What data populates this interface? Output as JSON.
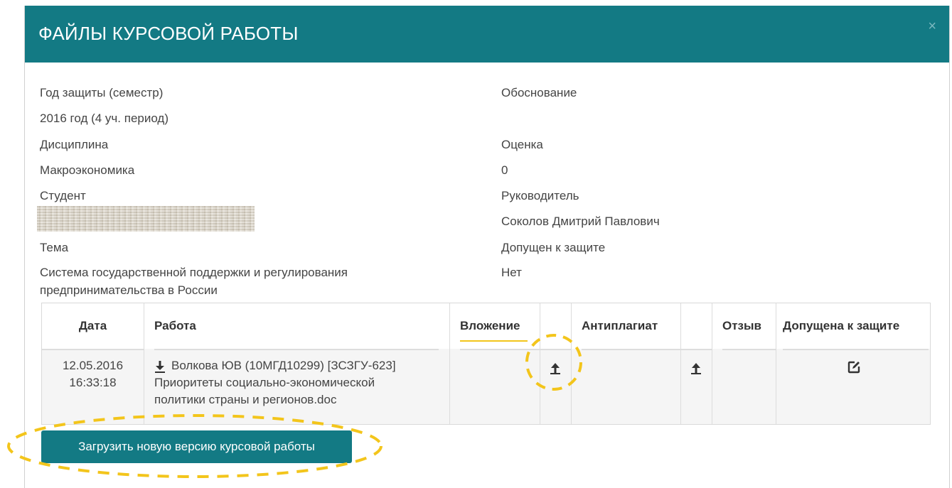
{
  "modal": {
    "title": "ФАЙЛЫ КУРСОВОЙ РАБОТЫ",
    "close_label": "×"
  },
  "info": {
    "year_label": "Год защиты (семестр)",
    "year_value": "2016 год (4 уч. период)",
    "discipline_label": "Дисциплина",
    "discipline_value": "Макроэкономика",
    "student_label": "Студент",
    "topic_label": "Тема",
    "topic_value_line1": "Система государственной поддержки и регулирования",
    "topic_value_line2": "предпринимательства в России",
    "basis_label": "Обоснование",
    "grade_label": "Оценка",
    "grade_value": "0",
    "supervisor_label": "Руководитель",
    "supervisor_value": "Соколов Дмитрий Павлович",
    "admitted_label": "Допущен к защите",
    "admitted_value": "Нет"
  },
  "table": {
    "headers": [
      "Дата",
      "Работа",
      "Вложение",
      "Антиплагиат",
      "Отзыв",
      "Допущена к защите"
    ],
    "row": {
      "date": "12.05.2016",
      "time": "16:33:18",
      "file_line1": "Волкова ЮВ (10МГД10299) [ЗСЗГУ-623]",
      "file_line2": "Приоритеты социально-экономической",
      "file_line3": "политики страны и регионов.doc"
    }
  },
  "actions": {
    "upload_label": "Загрузить новую версию курсовой работы"
  },
  "colors": {
    "header_bg": "#137a84",
    "highlight": "#f3c51b"
  },
  "icons": [
    "close-icon",
    "download-icon",
    "upload-icon",
    "edit-icon"
  ]
}
